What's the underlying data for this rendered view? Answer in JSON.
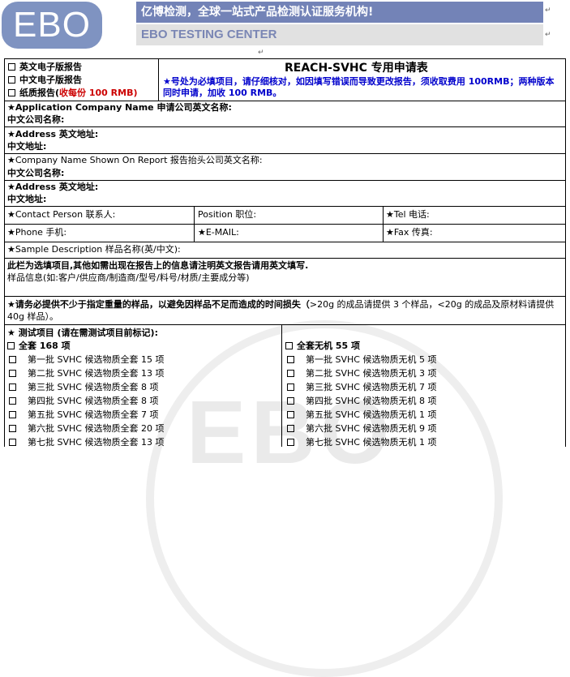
{
  "header": {
    "logo_text": "EBO",
    "slogan": "亿博检测，全球一站式产品检测认证服务机构!",
    "center_name": "EBO TESTING CENTER",
    "para_mark": "↵"
  },
  "form": {
    "title": "REACH-SVHC 专用申请表",
    "notice": "★号处为必填项目，请仔细核对，如因填写错误而导致更改报告，须收取费用 100RMB；两种版本同时申请，加收 100 RMB。",
    "report_types": [
      {
        "label": "英文电子版报告"
      },
      {
        "label": "中文电子版报告"
      },
      {
        "label": "纸质报告(",
        "extra": "收每份 100 RMB)"
      }
    ],
    "applicant": {
      "company_en_label": "★Application Company Name  申请公司英文名称:",
      "company_cn_label": "中文公司名称:",
      "address_en_label": "★Address  英文地址:",
      "address_cn_label": "中文地址:"
    },
    "report_company": {
      "company_en_label": "★Company Name Shown On Report  报告抬头公司英文名称:",
      "company_cn_label": "中文公司名称:",
      "address_en_label": "★Address  英文地址:",
      "address_cn_label": "中文地址:"
    },
    "contact": {
      "person_label": "★Contact Person 联系人:",
      "position_label": "Position 职位:",
      "tel_label": "★Tel 电话:",
      "phone_label": "★Phone 手机:",
      "email_label": "★E-MAIL:",
      "fax_label": "★Fax 传真:"
    },
    "sample": {
      "desc_label": "★Sample Description 样品名称(英/中文):",
      "note_bold": "此栏为选填项目,其他如需出现在报告上的信息请注明英文报告请用英文填写.",
      "note_normal": "样品信息(如:客户/供应商/制造商/型号/料号/材质/主要成分等)"
    },
    "sample_warning_bold": "★请务必提供不少于指定重量的样品，以避免因样品不足而造成的时间损失（",
    "sample_warning_normal": ">20g 的成品请提供 3 个样品，<20g 的成品及原材料请提供 40g 样品）。",
    "tests": {
      "header": "★   测试项目 (请在需测试项目前标记):",
      "left_all": "全套 168 项",
      "right_all": "全套无机 55 项",
      "left_items": [
        "第一批 SVHC 候选物质全套  15 项",
        "第二批 SVHC 候选物质全套 13 项",
        "第三批 SVHC 候选物质全套 8 项",
        "第四批 SVHC 候选物质全套 8 项",
        "第五批 SVHC 候选物质全套 7 项",
        "第六批 SVHC 候选物质全套 20 项",
        "第七批 SVHC 候选物质全套 13 项"
      ],
      "right_items": [
        "第一批 SVHC 候选物质无机 5 项",
        "第二批 SVHC 候选物质无机 3 项",
        "第三批 SVHC 候选物质无机 7 项",
        "第四批 SVHC 候选物质无机 8 项",
        "第五批 SVHC 候选物质无机 1 项",
        "第六批 SVHC 候选物质无机 9 项",
        "第七批 SVHC 候选物质无机 1 项"
      ]
    }
  }
}
